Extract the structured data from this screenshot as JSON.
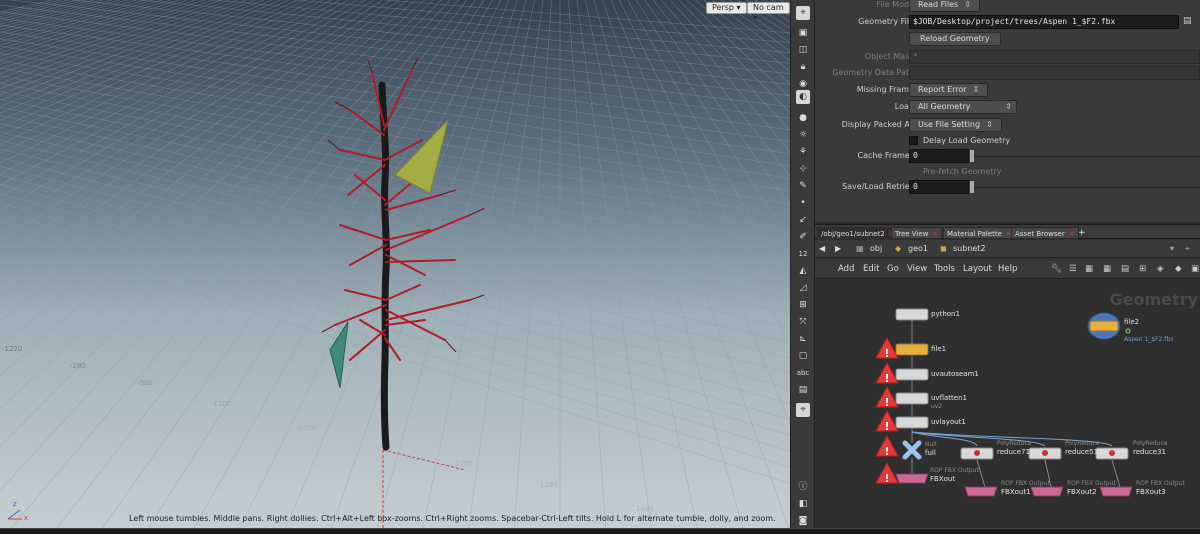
{
  "viewport": {
    "persp_label": "Persp ▾",
    "cam_label": "No cam ▾",
    "hint": "Left mouse tumbles. Middle pans. Right dollies. Ctrl+Alt+Left box-zooms. Ctrl+Right zooms. Spacebar-Ctrl-Left tilts. Hold L for alternate tumble, dolly, and zoom.",
    "grid_labels": [
      "-1220",
      "-280",
      "-960",
      "-1100",
      "-1200",
      "1220",
      "1280",
      "1640"
    ],
    "axis_labels": [
      "z",
      "x"
    ]
  },
  "toolstrip": {
    "icons": [
      "pin-icon",
      "scene-view-icon",
      "wire-icon",
      "lock-icon",
      "shade-icon",
      "xray-icon",
      "sphere-icon",
      "select-icon",
      "light-icon",
      "bulb-icon",
      "network-icon",
      "snap-icon",
      "paint-icon",
      "point-icon",
      "tangent-icon",
      "pen-icon",
      "counter-icon",
      "bucket-icon",
      "ruler-icon",
      "grid-icon",
      "transform-icon",
      "measure-icon",
      "toggle-icon",
      "text-icon",
      "image-icon",
      "pin2-icon",
      "info-icon",
      "color-icon",
      "display-icon"
    ],
    "counter_text": "12",
    "abc_text": "abc"
  },
  "params": {
    "file_mode_label": "File Mode",
    "file_mode_value": "Read Files",
    "geometry_file_label": "Geometry File",
    "geometry_file_value": "$JOB/Desktop/project/trees/Aspen 1_$F2.fbx",
    "reload_label": "Reload Geometry",
    "object_mask_label": "Object Mask",
    "object_mask_value": "*",
    "data_path_label": "Geometry Data Path",
    "missing_frame_label": "Missing Frame",
    "missing_frame_value": "Report Error",
    "load_label": "Load",
    "load_value": "All Geometry",
    "display_packed_label": "Display Packed As",
    "display_packed_value": "Use File Setting",
    "delay_load_label": "Delay Load Geometry",
    "cache_frames_label": "Cache Frames",
    "cache_frames_value": "0",
    "prefetch_label": "Pre-fetch Geometry",
    "save_load_label": "Save/Load Retries",
    "save_load_value": "0"
  },
  "network": {
    "tabs": [
      "/obj/geo1/subnet2",
      "Tree View",
      "Material Palette",
      "Asset Browser",
      "+"
    ],
    "path": [
      "obj",
      "geo1",
      "subnet2"
    ],
    "menus": [
      "Add",
      "Edit",
      "Go",
      "View",
      "Tools",
      "Layout",
      "Help"
    ],
    "context_label": "Geometry",
    "nodes": {
      "python1": "python1",
      "file1": "file1",
      "uvautoseam1": "uvautoseam1",
      "uvflatten1": "uvflatten1",
      "uv2": "uv2",
      "uvlayout1": "uvlayout1",
      "null_type": "Null",
      "full": "full",
      "rop_type": "ROP FBX Output",
      "fbxout": "FBXout",
      "polyreduce_type": "PolyReduce",
      "reduce71": "reduce71",
      "reduce51": "reduce51",
      "reduce31": "reduce31",
      "fbxout1": "FBXout1",
      "fbxout2": "FBXout2",
      "fbxout3": "FBXout3",
      "file2": "file2",
      "file2_path": "Aspen 1_$F2.fbx"
    }
  },
  "colors": {
    "warning": "#e03a3a",
    "rop": "#c86a95",
    "file_node": "#e8b040",
    "wire": "#7ba6d8",
    "tree_red": "#b01c2a"
  }
}
